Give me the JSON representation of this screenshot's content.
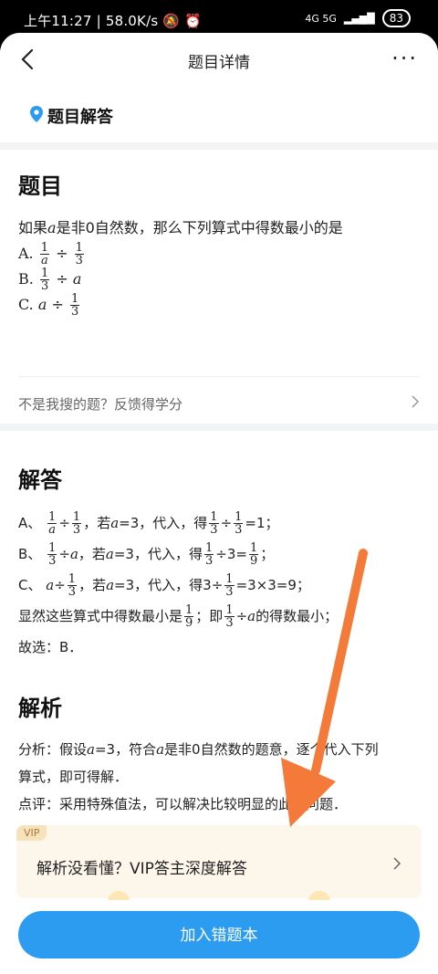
{
  "status_bar": {
    "time": "上午11:27",
    "speed": "58.0K/s",
    "signal": "4G  5G",
    "battery": "83"
  },
  "nav": {
    "title": "题目详情",
    "more": "···"
  },
  "tag": {
    "label": "题目解答"
  },
  "question": {
    "heading": "题目",
    "stem_before": "如果",
    "stem_after": "是非0自然数，那么下列算式中得数最小的是",
    "var": "a",
    "options": [
      {
        "prefix": "A."
      },
      {
        "prefix": "B."
      },
      {
        "prefix": "C."
      }
    ],
    "frac_one": "1",
    "frac_three": "3",
    "div": "÷"
  },
  "feedback": {
    "text": "不是我搜的题？反馈得学分"
  },
  "answer": {
    "heading": "解答",
    "lines": {
      "a_prefix": "A、",
      "a_text1": "，若",
      "a_text2": "=3，代入，得",
      "a_text3": "=1；",
      "b_prefix": "B、",
      "b_text1": "，若",
      "b_text2": "=3，代入，得",
      "b_text3": "÷3=",
      "c_prefix": "C、",
      "c_text1": "，若",
      "c_text2": "=3，代入，得3÷",
      "c_text3": "=3×3=9；",
      "d_text1": "显然这些算式中得数最小是",
      "d_text2": "；即",
      "d_text3": "÷",
      "d_text4": "的得数最小；",
      "e_text": "故选：B．",
      "nine": "9"
    }
  },
  "analysis": {
    "heading": "解析",
    "line1": "分析：假设",
    "line1b": "=3，符合",
    "line1c": "是非0自然数的题意，逐个代入下列",
    "line2": "算式，即可得解．",
    "line3": "点评：采用特殊值法，可以解决比较明显的此类问题．"
  },
  "vip": {
    "badge": "VIP",
    "text": "解析没看懂？VIP答主深度解答"
  },
  "bottom": {
    "button": "加入错题本"
  },
  "colors": {
    "primary": "#2c9cf1",
    "arrow": "#f47a3a",
    "vip_bg": "#fdf6ea"
  }
}
